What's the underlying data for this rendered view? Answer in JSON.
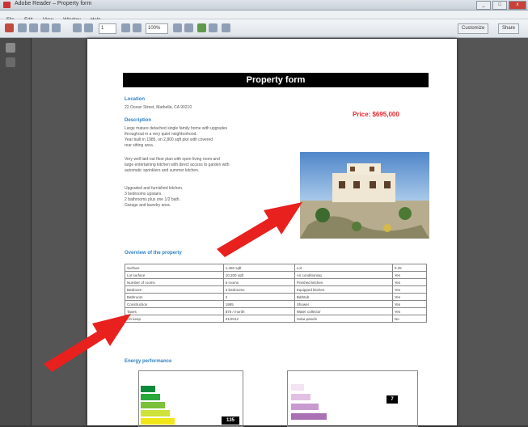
{
  "window": {
    "title": "Adobe Reader – Property form",
    "min": "_",
    "max": "□",
    "close": "x"
  },
  "menu": [
    "File",
    "Edit",
    "View",
    "Window",
    "Help"
  ],
  "toolbar": {
    "page_field": "1",
    "zoom_field": "100%",
    "right_button_1": "Customize",
    "right_button_2": "Share"
  },
  "document": {
    "header": "Property form",
    "location_label": "Location",
    "location_value": "22 Ocean Street, Marbella, CA 90210",
    "price": "Price: $695,000",
    "description_label": "Description",
    "description_lines_1": [
      "Large mature detached single family home with upgrades",
      "throughout in a very quiet neighborhood.",
      "Year built in 1985, on 2,800 sqft plot with covered",
      "rear sitting area."
    ],
    "description_lines_2": [
      "Very well laid-out floor plan with open living room and",
      "large entertaining kitchen with direct access to garden with",
      "automatic sprinklers and summer kitchen."
    ],
    "description_lines_3": [
      "Upgraded and furnished kitchen.",
      "3 bedrooms upstairs.",
      "2 bathrooms plus one 1/2 bath.",
      "Garage and laundry area."
    ],
    "overview_label": "Overview of the property",
    "table": [
      [
        "Surface",
        "1,450 sqft",
        "Lot",
        "0.25"
      ],
      [
        "Lot surface",
        "10,200 sqft",
        "Air conditioning",
        "Yes"
      ],
      [
        "Number of rooms",
        "6 rooms",
        "Finished kitchen",
        "Yes"
      ],
      [
        "Bedroom",
        "3 bedrooms",
        "Equipped kitchen",
        "Yes"
      ],
      [
        "Bathroom",
        "2",
        "Bathtub",
        "Yes"
      ],
      [
        "Construction",
        "1985",
        "Shower",
        "Yes"
      ],
      [
        "Taxes",
        "$75 / month",
        "Water collector",
        "Yes"
      ],
      [
        "On keep",
        "01/2012",
        "Solar panels",
        "No"
      ]
    ],
    "energy_label": "Energy performance",
    "energy_rating": "135",
    "emission_rating": "7"
  },
  "colors": {
    "accent_blue": "#2f80c4",
    "price_red": "#e8282d",
    "arrow_red": "#e8201e"
  }
}
